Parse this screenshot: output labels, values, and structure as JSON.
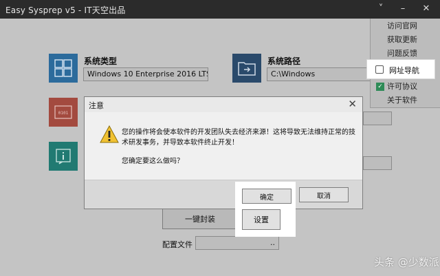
{
  "window": {
    "title": "Easy Sysprep v5 - IT天空出品",
    "min_glyph": "–",
    "chevron_glyph": "˅",
    "close_glyph": "✕"
  },
  "main": {
    "system_type_label": "系统类型",
    "system_type_value": "Windows 10 Enterprise 2016 LTS ..",
    "system_path_label": "系统路径",
    "system_path_value": "C:\\Windows",
    "one_click_button": "一键封装",
    "config_file_label": "配置文件",
    "config_file_value": ".."
  },
  "menu": {
    "items": [
      {
        "label": "访问官网"
      },
      {
        "label": "获取更新"
      },
      {
        "label": "问题反馈"
      },
      {
        "label": "网址导航",
        "checked": false
      },
      {
        "label": "许可协议",
        "checked": true
      },
      {
        "label": "关于软件"
      }
    ]
  },
  "dialog": {
    "title": "注意",
    "close_glyph": "✕",
    "message_line1": "您的操作将会使本软件的开发团队失去经济来源！这将导致无法维持正常的技",
    "message_line2": "术研发事务，并导致本软件终止开发！",
    "question": "您确定要这么做吗？",
    "ok_label": "确定",
    "cancel_label": "取消"
  },
  "settings_button": "设置",
  "watermark": "头条 @少数派",
  "colors": {
    "tile_blue": "#2c6b9c",
    "tile_red": "#a34a3f",
    "tile_teal": "#217a72",
    "tile_navy": "#2a4a6b",
    "warning_yellow": "#f1c232",
    "check_green": "#2e8b57"
  }
}
